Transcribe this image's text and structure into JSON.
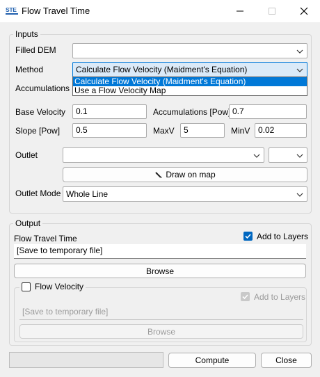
{
  "window": {
    "icon_text": "STE",
    "title": "Flow Travel Time"
  },
  "inputs": {
    "legend": "Inputs",
    "filled_dem_label": "Filled DEM",
    "filled_dem_value": "",
    "method_label": "Method",
    "method_value": "Calculate Flow Velocity (Maidment's Equation)",
    "method_options": [
      "Calculate Flow Velocity (Maidment's Equation)",
      "Use a Flow Velocity Map"
    ],
    "accumulations_label": "Accumulations",
    "base_velocity_label": "Base Velocity",
    "base_velocity_value": "0.1",
    "accum_pow_label": "Accumulations [Pow]",
    "accum_pow_value": "0.7",
    "slope_pow_label": "Slope [Pow]",
    "slope_pow_value": "0.5",
    "maxv_label": "MaxV",
    "maxv_value": "5",
    "minv_label": "MinV",
    "minv_value": "0.02",
    "outlet_label": "Outlet",
    "outlet_value": "",
    "outlet_field_value": "",
    "draw_button": "Draw on map",
    "outlet_mode_label": "Outlet Mode",
    "outlet_mode_value": "Whole Line"
  },
  "output": {
    "legend": "Output",
    "flow_travel_time_label": "Flow Travel Time",
    "add_to_layers_label": "Add to Layers",
    "add_to_layers_checked": true,
    "save_path": "[Save to temporary file]",
    "browse_label": "Browse",
    "flow_velocity": {
      "label": "Flow Velocity",
      "checked": false,
      "add_to_layers_label": "Add to Layers",
      "save_path": "[Save to temporary file]",
      "browse_label": "Browse"
    }
  },
  "footer": {
    "progress": 0,
    "compute_label": "Compute",
    "close_label": "Close"
  }
}
